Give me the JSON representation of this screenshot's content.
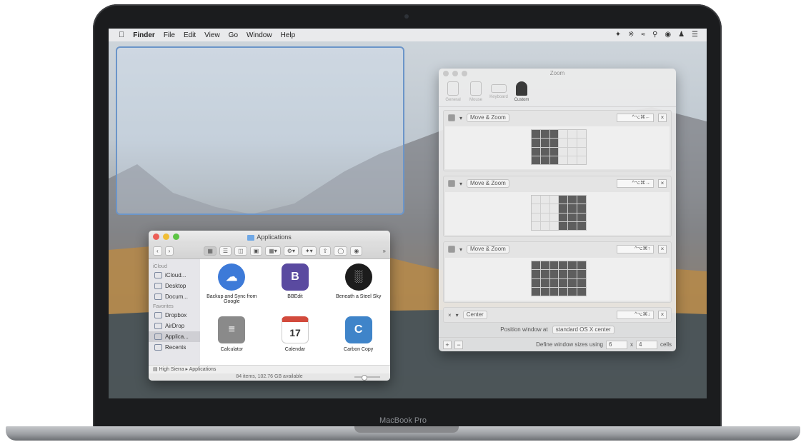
{
  "menubar": {
    "apple_icon": "apple-icon",
    "items": [
      "Finder",
      "File",
      "Edit",
      "View",
      "Go",
      "Window",
      "Help"
    ],
    "status_icons": [
      "dropbox-icon",
      "bluetooth-icon",
      "wifi-icon",
      "spotlight-icon",
      "siri-icon",
      "user-icon",
      "notification-center-icon"
    ]
  },
  "finder": {
    "title": "Applications",
    "sidebar": {
      "icloud_header": "iCloud",
      "favorites_header": "Favorites",
      "items": [
        "iCloud...",
        "Desktop",
        "Docum...",
        "Dropbox",
        "AirDrop",
        "Applica...",
        "Recents"
      ]
    },
    "apps": [
      {
        "label": "Backup and Sync from Google",
        "color": "#3d7ad8",
        "glyph": "☁"
      },
      {
        "label": "BBEdit",
        "color": "#5a4aa0",
        "glyph": "B"
      },
      {
        "label": "Beneath a Steel Sky",
        "color": "#1c1c1c",
        "glyph": "░"
      },
      {
        "label": "Calculator",
        "color": "#8a8a8a",
        "glyph": "≡"
      },
      {
        "label": "Calendar",
        "color": "#d24a3c",
        "glyph": "17"
      },
      {
        "label": "Carbon Copy",
        "color": "#3f84c9",
        "glyph": "C"
      }
    ],
    "path": {
      "drive": "High Sierra",
      "folder": "Applications"
    },
    "status": "84 items, 102.76 GB available"
  },
  "zoom_prefs": {
    "title": "Zoom",
    "tabs": [
      "General",
      "Mouse",
      "Keyboard",
      "Custom"
    ],
    "rules": [
      {
        "action": "Move & Zoom",
        "hotkey": "^⌥⌘←",
        "filled": [
          0,
          1,
          2,
          6,
          7,
          8,
          12,
          13,
          14,
          18,
          19,
          20
        ]
      },
      {
        "action": "Move & Zoom",
        "hotkey": "^⌥⌘→",
        "filled": [
          3,
          4,
          5,
          9,
          10,
          11,
          15,
          16,
          17,
          21,
          22,
          23
        ]
      },
      {
        "action": "Move & Zoom",
        "hotkey": "^⌥⌘↑",
        "filled": [
          0,
          1,
          2,
          3,
          4,
          5,
          6,
          7,
          8,
          9,
          10,
          11,
          12,
          13,
          14,
          15,
          16,
          17,
          18,
          19,
          20,
          21,
          22,
          23
        ]
      },
      {
        "action": "Center",
        "hotkey": "^⌥⌘↓"
      }
    ],
    "position_label": "Position window at",
    "position_value": "standard OS X center",
    "define_label": "Define window sizes using",
    "cols": "6",
    "times": "x",
    "rows": "4",
    "cells_label": "cells",
    "add_label": "+",
    "remove_label": "−",
    "remove_rule_label": "×"
  },
  "device_label": "MacBook Pro"
}
